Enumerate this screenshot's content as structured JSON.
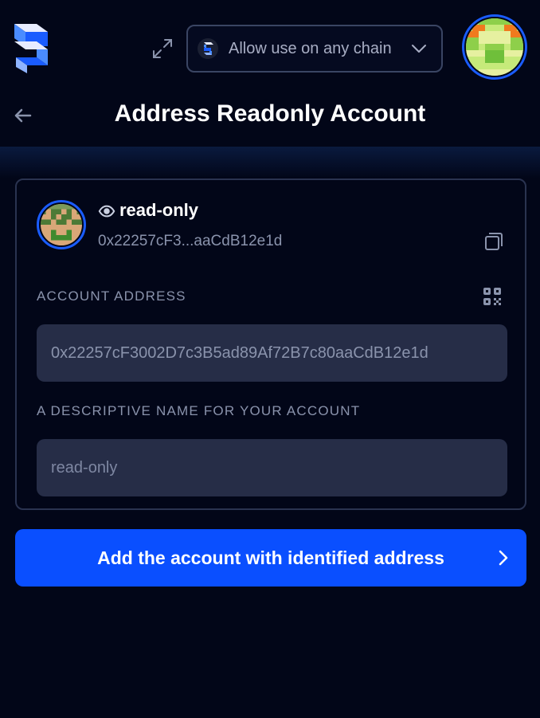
{
  "header": {
    "chain_selector_label": "Allow use on any chain",
    "colors": {
      "accent": "#0a4fff",
      "avatar_ring": "#1a5cff"
    }
  },
  "page": {
    "title": "Address Readonly Account"
  },
  "account": {
    "name": "read-only",
    "short_address": "0x22257cF3...aaCdB12e1d"
  },
  "form": {
    "address_label": "Account address",
    "address_value": "0x22257cF3002D7c3B5ad89Af72B7c80aaCdB12e1d",
    "name_label": "A descriptive name for your account",
    "name_placeholder": "read-only"
  },
  "actions": {
    "submit_label": "Add the account with identified address"
  },
  "icons": [
    "logo-icon",
    "expand-icon",
    "chain-logo-icon",
    "chevron-down-icon",
    "back-arrow-icon",
    "eye-icon",
    "copy-icon",
    "qr-code-icon",
    "chevron-right-icon"
  ]
}
